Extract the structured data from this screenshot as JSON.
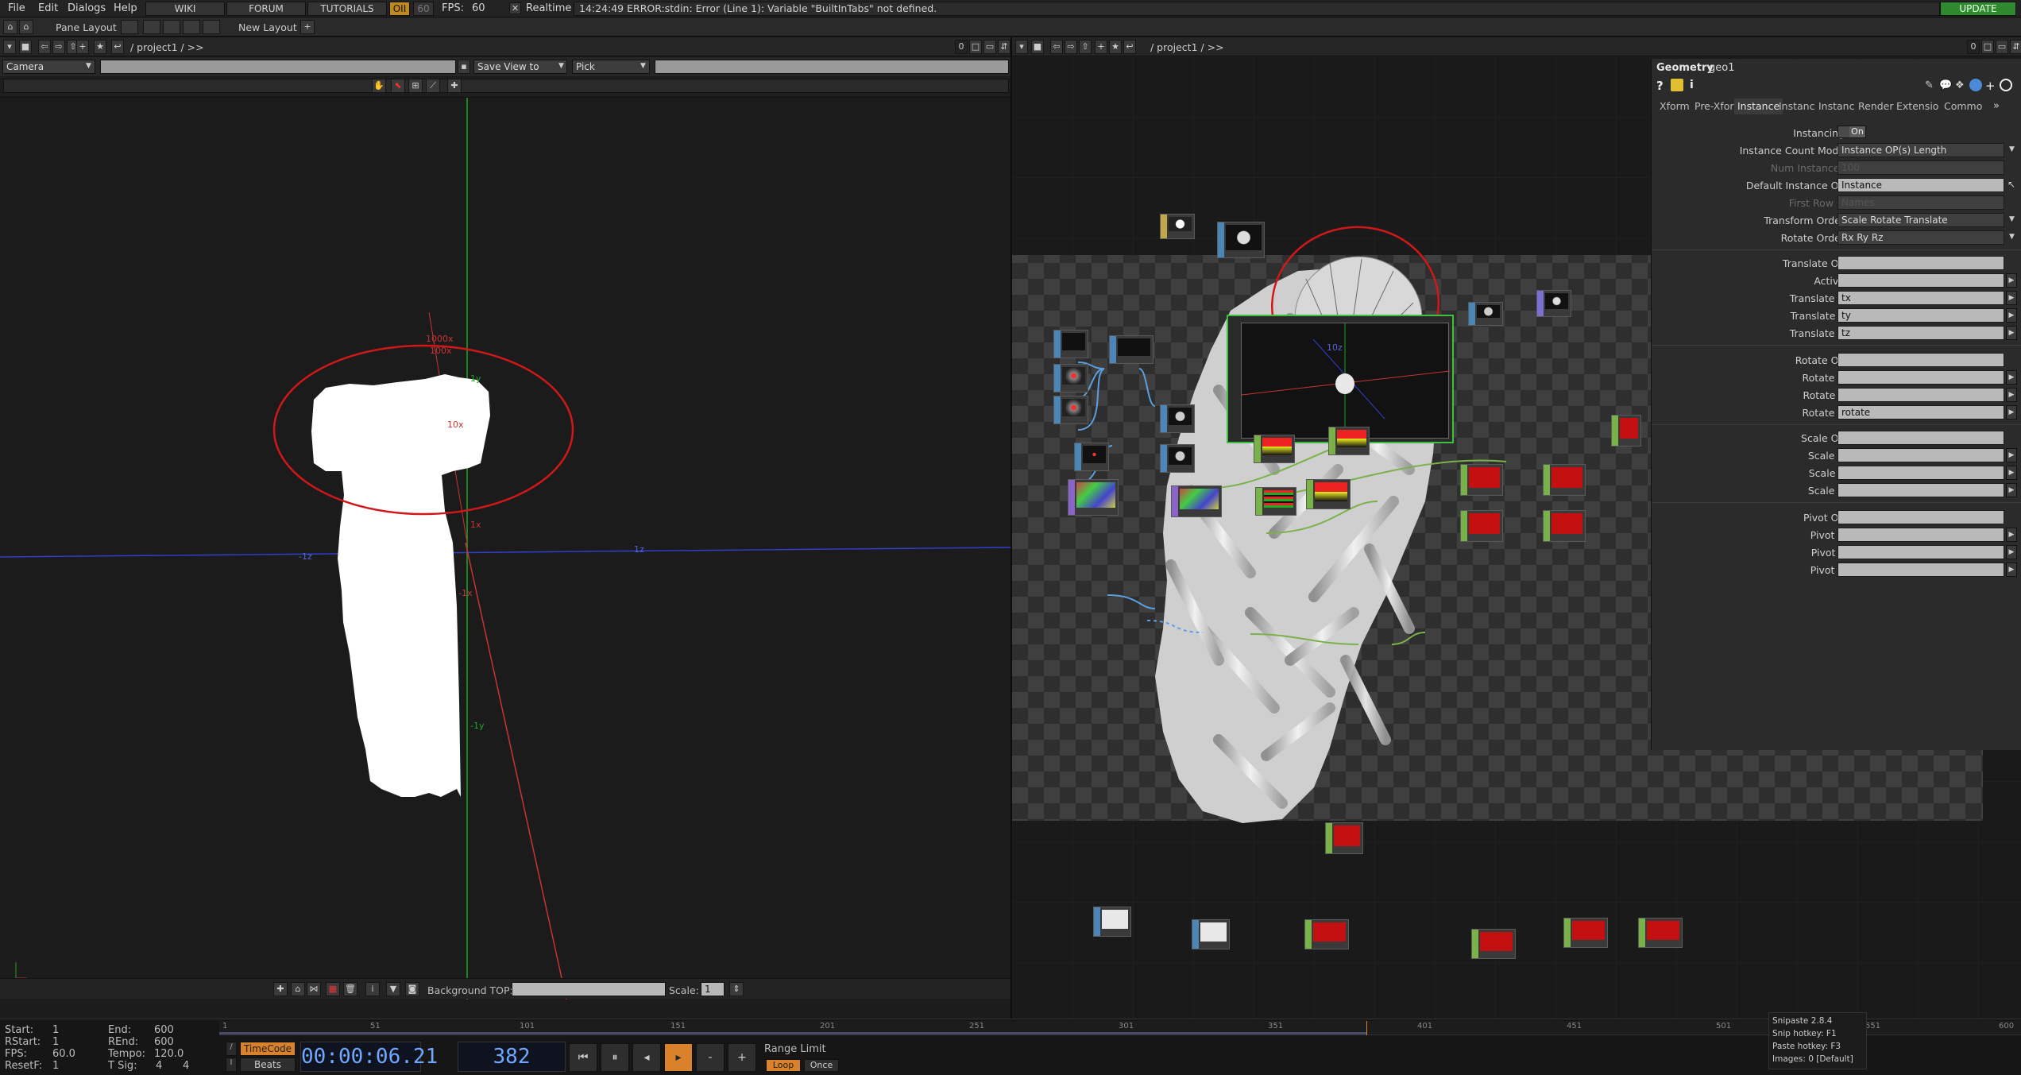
{
  "menu": {
    "file": "File",
    "edit": "Edit",
    "dialogs": "Dialogs",
    "help": "Help"
  },
  "nav": {
    "wiki": "WIKI",
    "forum": "FORUM",
    "tutorials": "TUTORIALS",
    "perf_badge": "OII",
    "fps_cap": "60",
    "fps_label": "FPS:",
    "fps_value": "60",
    "realtime": "Realtime"
  },
  "error_message": "14:24:49 ERROR:stdin: Error (Line 1): Variable \"BuiltInTabs\" not defined.",
  "update_button": "UPDATE",
  "layout": {
    "pane_layout": "Pane Layout",
    "new_layout": "New Layout"
  },
  "left_pane": {
    "path": "/ project1 / >>",
    "pane_index": "0",
    "camera_select": "Camera",
    "save_view": "Save View to",
    "pick_select": "Pick",
    "background_top_label": "Background TOP:",
    "scale_label": "Scale:",
    "scale_value": "1",
    "axis_labels": {
      "t1000x": "1000x",
      "t100x": "100x",
      "t10x": "10x",
      "ty": "1y",
      "tx": "1x",
      "tmz": "-1z",
      "tz": "1z",
      "tmy": "-1y",
      "tmx": "-1x"
    }
  },
  "right_pane": {
    "path": "/ project1 / >>",
    "pane_index": "0",
    "viewer_labels": {
      "v10z": "10z"
    }
  },
  "geometry_panel": {
    "title": "Geometry",
    "name": "geo1",
    "tabs": [
      "Xform",
      "Pre-Xfor",
      "Instance",
      "Instanc",
      "Instanc",
      "Render",
      "Extensio",
      "Commo"
    ],
    "active_tab": "Instance",
    "params": {
      "instancing": {
        "label": "Instancing",
        "value": "On"
      },
      "count_mode": {
        "label": "Instance Count Mode",
        "value": "Instance OP(s) Length"
      },
      "num_instances": {
        "label": "Num Instances",
        "value": "100"
      },
      "default_op": {
        "label": "Default Instance OP",
        "value": "Instance"
      },
      "first_row": {
        "label": "First Row is",
        "value": "Names"
      },
      "transform_order": {
        "label": "Transform Order",
        "value": "Scale Rotate Translate"
      },
      "rotate_order": {
        "label": "Rotate Order",
        "value": "Rx Ry Rz"
      },
      "translate_op": {
        "label": "Translate OP",
        "value": ""
      },
      "active": {
        "label": "Active",
        "value": ""
      },
      "translate_x": {
        "label": "Translate X",
        "value": "tx"
      },
      "translate_y": {
        "label": "Translate Y",
        "value": "ty"
      },
      "translate_z": {
        "label": "Translate Z",
        "value": "tz"
      },
      "rotate_op": {
        "label": "Rotate OP",
        "value": ""
      },
      "rotate_x": {
        "label": "Rotate X",
        "value": ""
      },
      "rotate_y": {
        "label": "Rotate Y",
        "value": ""
      },
      "rotate_z": {
        "label": "Rotate Z",
        "value": "rotate"
      },
      "scale_op": {
        "label": "Scale OP",
        "value": ""
      },
      "scale_x": {
        "label": "Scale X",
        "value": ""
      },
      "scale_y": {
        "label": "Scale Y",
        "value": ""
      },
      "scale_z": {
        "label": "Scale Z",
        "value": ""
      },
      "pivot_op": {
        "label": "Pivot OP",
        "value": ""
      },
      "pivot_x": {
        "label": "Pivot X",
        "value": ""
      },
      "pivot_y": {
        "label": "Pivot Y",
        "value": ""
      },
      "pivot_z": {
        "label": "Pivot Z",
        "value": ""
      }
    }
  },
  "timeline": {
    "start": {
      "label": "Start:",
      "value": "1"
    },
    "end": {
      "label": "End:",
      "value": "600"
    },
    "rstart": {
      "label": "RStart:",
      "value": "1"
    },
    "rend": {
      "label": "REnd:",
      "value": "600"
    },
    "fps": {
      "label": "FPS:",
      "value": "60.0"
    },
    "tempo": {
      "label": "Tempo:",
      "value": "120.0"
    },
    "resetf": {
      "label": "ResetF:",
      "value": "1"
    },
    "tsig": {
      "label": "T Sig:",
      "value": "4",
      "value2": "4"
    },
    "timecode_btn": "TimeCode",
    "beats_btn": "Beats",
    "timecode": "00:00:06.21",
    "frame": "382",
    "range_limit": "Range Limit",
    "loop": "Loop",
    "once": "Once",
    "ruler_ticks": [
      "1",
      "51",
      "101",
      "151",
      "201",
      "251",
      "301",
      "351",
      "401",
      "451",
      "501",
      "551",
      "600"
    ]
  },
  "snipaste": {
    "line1": "Snipaste 2.8.4",
    "line2": "Snip hotkey: F1",
    "line3": "Paste hotkey: F3",
    "line4": "Images: 0 [Default]"
  },
  "colors": {
    "accent_orange": "#d9822b",
    "update_green": "#2f8a2f",
    "annotation_red": "#d01818",
    "timecode_blue": "#6fa8ff"
  }
}
